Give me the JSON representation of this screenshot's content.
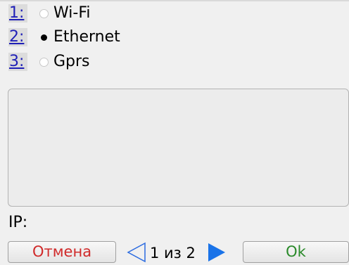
{
  "options": [
    {
      "number": "1:",
      "label": "Wi-Fi",
      "selected": false
    },
    {
      "number": "2:",
      "label": "Ethernet",
      "selected": true
    },
    {
      "number": "3:",
      "label": "Gprs",
      "selected": false
    }
  ],
  "details": {
    "text": ""
  },
  "ip": {
    "label": "IP:"
  },
  "footer": {
    "cancel_label": "Отмена",
    "ok_label": "Ok",
    "page_text": "1 из 2",
    "current_page": 1,
    "total_pages": 2
  },
  "colors": {
    "background": "#f0f0f0",
    "number_link": "#1f1fb7",
    "cancel_text": "#d02a2a",
    "ok_text": "#2a8a2a",
    "prev_arrow": "#2b6be0",
    "next_arrow": "#1a73e8"
  },
  "icons": {
    "prev": "triangle-left-outline-icon",
    "next": "triangle-right-filled-icon"
  }
}
